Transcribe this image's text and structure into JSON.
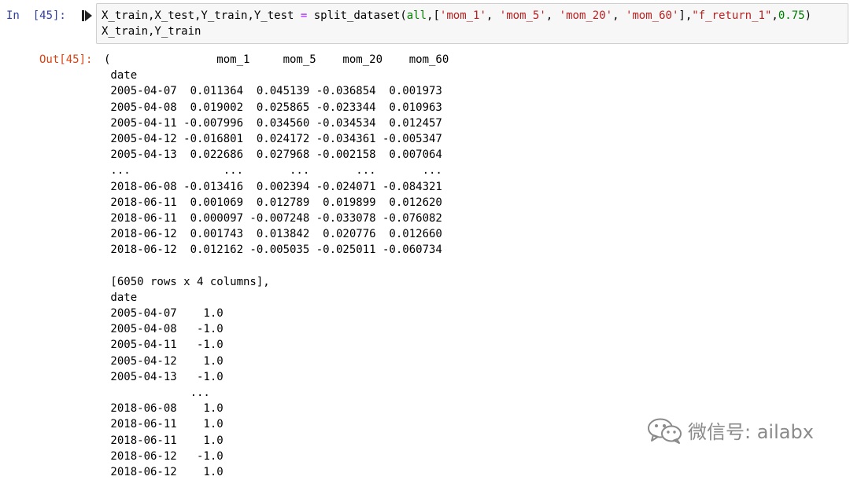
{
  "input_cell": {
    "prompt": "In  [45]:",
    "code_lines": [
      [
        "X_train,X_test,Y_train,Y_test ",
        "=",
        " split_dataset(",
        "all",
        ",[",
        "'mom_1'",
        ", ",
        "'mom_5'",
        ", ",
        "'mom_20'",
        ", ",
        "'mom_60'",
        "],",
        "\"f_return_1\"",
        ",",
        "0.75",
        ")"
      ],
      [
        "X_train,Y_train"
      ]
    ]
  },
  "output_cell": {
    "prompt": "Out[45]:",
    "lines": [
      "(                mom_1     mom_5    mom_20    mom_60",
      " date",
      " 2005-04-07  0.011364  0.045139 -0.036854  0.001973",
      " 2005-04-08  0.019002  0.025865 -0.023344  0.010963",
      " 2005-04-11 -0.007996  0.034560 -0.034534  0.012457",
      " 2005-04-12 -0.016801  0.024172 -0.034361 -0.005347",
      " 2005-04-13  0.022686  0.027968 -0.002158  0.007064",
      " ...              ...       ...       ...       ...",
      " 2018-06-08 -0.013416  0.002394 -0.024071 -0.084321",
      " 2018-06-11  0.001069  0.012789  0.019899  0.012620",
      " 2018-06-11  0.000097 -0.007248 -0.033078 -0.076082",
      " 2018-06-12  0.001743  0.013842  0.020776  0.012660",
      " 2018-06-12  0.012162 -0.005035 -0.025011 -0.060734",
      "",
      " [6050 rows x 4 columns],",
      " date",
      " 2005-04-07    1.0",
      " 2005-04-08   -1.0",
      " 2005-04-11   -1.0",
      " 2005-04-12    1.0",
      " 2005-04-13   -1.0",
      "             ...",
      " 2018-06-08    1.0",
      " 2018-06-11    1.0",
      " 2018-06-11    1.0",
      " 2018-06-12   -1.0",
      " 2018-06-12    1.0"
    ]
  },
  "watermark": {
    "text": "微信号: ailabx",
    "icon": "wechat-icon"
  },
  "colors": {
    "in_prompt": "#303f9f",
    "out_prompt": "#d84315",
    "input_bg": "#f7f7f7",
    "watermark": "#8a8a8a"
  }
}
